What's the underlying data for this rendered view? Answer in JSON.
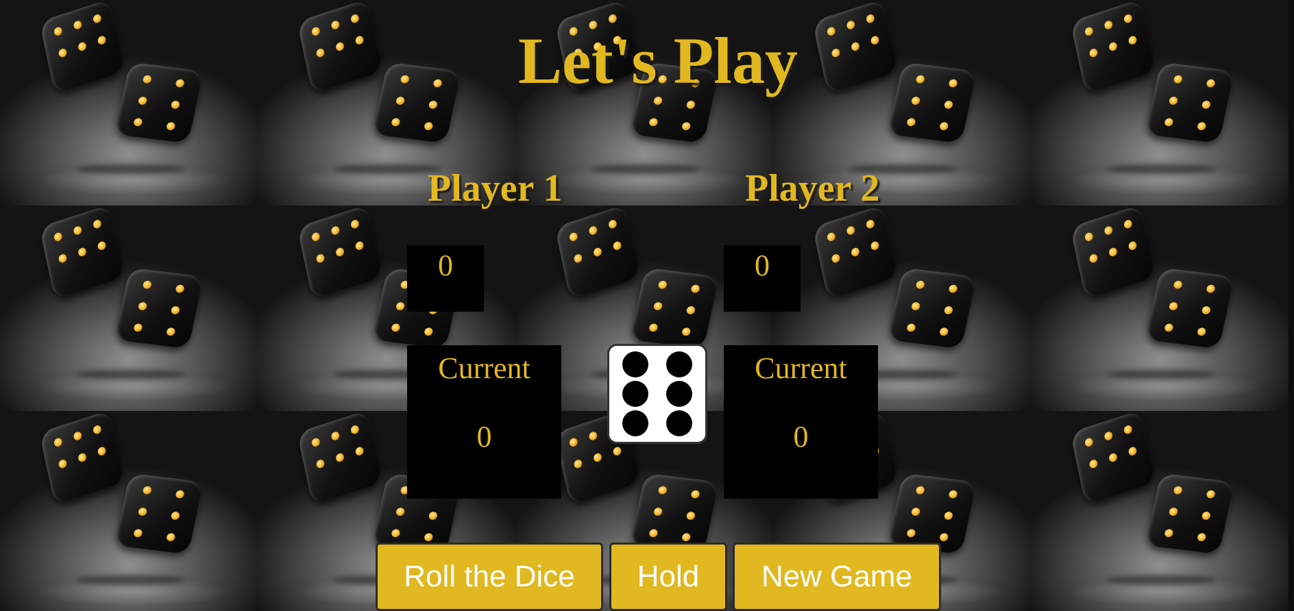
{
  "title": "Let's Play",
  "players": [
    {
      "name": "Player 1",
      "score": "0",
      "current_label": "Current",
      "current_value": "0"
    },
    {
      "name": "Player 2",
      "score": "0",
      "current_label": "Current",
      "current_value": "0"
    }
  ],
  "dice": {
    "face": 6
  },
  "buttons": {
    "roll": "Roll the Dice",
    "hold": "Hold",
    "new_game": "New Game"
  },
  "colors": {
    "accent": "#e1b81f",
    "box_background": "#000000",
    "button_text": "#ffffff"
  }
}
